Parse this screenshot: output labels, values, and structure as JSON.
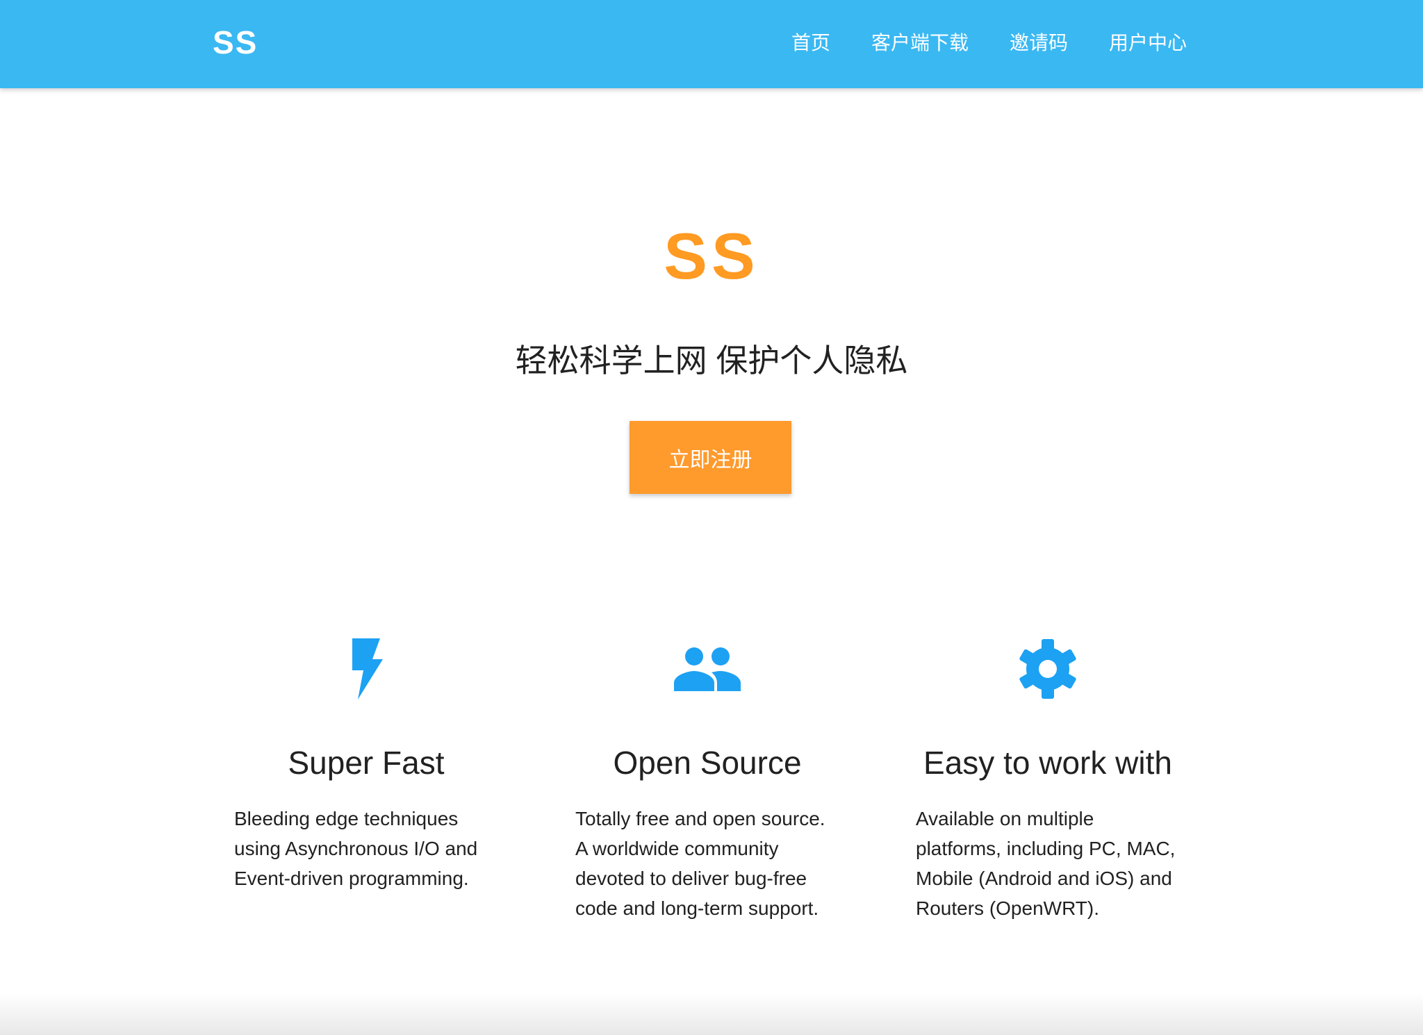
{
  "navbar": {
    "brand": "SS",
    "links": [
      "首页",
      "客户端下载",
      "邀请码",
      "用户中心"
    ],
    "color": "#3ab8f2"
  },
  "hero": {
    "title": "SS",
    "subtitle": "轻松科学上网 保护个人隐私",
    "button_label": "立即注册",
    "accent_color": "#ff9a22"
  },
  "features": [
    {
      "icon": "flash-icon",
      "title": "Super Fast",
      "lines": [
        "Bleeding edge techniques",
        "using Asynchronous I/O and",
        "Event-driven programming."
      ]
    },
    {
      "icon": "people-icon",
      "title": "Open Source",
      "lines": [
        "Totally free and open source.",
        "A worldwide community",
        "devoted to deliver bug-free",
        "code and long-term support."
      ]
    },
    {
      "icon": "gear-icon",
      "title": "Easy to work with",
      "lines": [
        "Available on multiple",
        "platforms, including PC, MAC,",
        "Mobile (Android and iOS) and",
        "Routers (OpenWRT)."
      ]
    }
  ],
  "icon_color": "#1da1f2"
}
